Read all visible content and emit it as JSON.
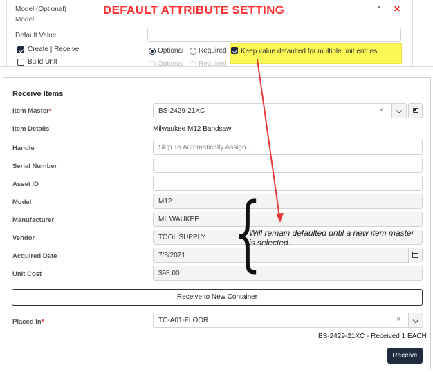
{
  "attribute_panel": {
    "title": "Model  (Optional)",
    "subtitle": "Model",
    "overlay_title": "DEFAULT ATTRIBUTE SETTING",
    "default_value_label": "Default Value",
    "default_value": "",
    "create_receive_label": "Create | Receive",
    "create_receive_checked": true,
    "build_unit_label": "Build Unit",
    "build_unit_checked": false,
    "optional_label": "Optional",
    "required_label": "Required",
    "optional_label_2": "Optional",
    "required_label_2": "Required",
    "keep_value_label": "Keep value defaulted for multiple unit entries.",
    "keep_value_checked": true,
    "highlight_color": "#fbf755",
    "overlay_color": "#ff3030"
  },
  "receive": {
    "title": "Receive Items",
    "fields": {
      "item_master_label": "Item Master",
      "item_master_value": "BS-2429-21XC",
      "item_details_label": "Item Details",
      "item_details_value": "Milwaukee M12 Bandsaw",
      "handle_label": "Handle",
      "handle_placeholder": "Skip To Automatically Assign...",
      "serial_label": "Serial Number",
      "serial_value": "",
      "asset_label": "Asset ID",
      "asset_value": "",
      "model_label": "Model",
      "model_value": "M12",
      "manufacturer_label": "Manufacturer",
      "manufacturer_value": "MILWAUKEE",
      "vendor_label": "Vendor",
      "vendor_value": "TOOL SUPPLY",
      "acquired_label": "Acquired Date",
      "acquired_value": "7/8/2021",
      "unit_cost_label": "Unit Cost",
      "unit_cost_value": "$98.00",
      "placed_in_label": "Placed In",
      "placed_in_value": "TC-A01-FLOOR"
    },
    "required_mark": "*",
    "clear_glyph": "×",
    "new_container_button": "Receive to New Container",
    "status_text": "BS-2429-21XC - Received 1 EACH",
    "receive_button": "Receive",
    "primary_color": "#1f2b3e"
  },
  "annotation": {
    "text": "Will remain defaulted until a new item master is selected.",
    "arrow_color": "#e8373a"
  },
  "icons": [
    "caret-up-icon",
    "close-icon",
    "checkbox-icon",
    "radio-icon",
    "chevron-down-icon",
    "lookup-icon",
    "calendar-icon",
    "clear-icon",
    "brace-icon",
    "arrow-icon"
  ]
}
